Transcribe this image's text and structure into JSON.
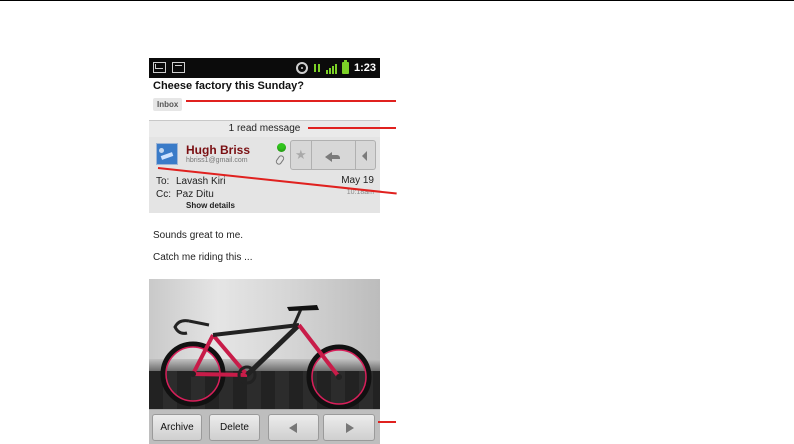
{
  "status_bar": {
    "time": "1:23"
  },
  "message": {
    "subject": "Cheese factory this Sunday?",
    "label": "Inbox",
    "read_messages_text": "1 read message",
    "sender_name": "Hugh Briss",
    "sender_email": "hbriss1@gmail.com",
    "to_label": "To:",
    "to_value": "Lavash Kiri",
    "cc_label": "Cc:",
    "cc_value": "Paz Ditu",
    "date": "May 19",
    "time": "10:18am",
    "show_details": "Show details",
    "body_line1": "Sounds great to me.",
    "body_line2": "Catch me riding this ..."
  },
  "toolbar": {
    "archive_label": "Archive",
    "delete_label": "Delete"
  },
  "colors": {
    "sender": "#7a0f12",
    "callout": "#e0211f",
    "presence": "#31c51d",
    "status_green": "#7cd127"
  }
}
